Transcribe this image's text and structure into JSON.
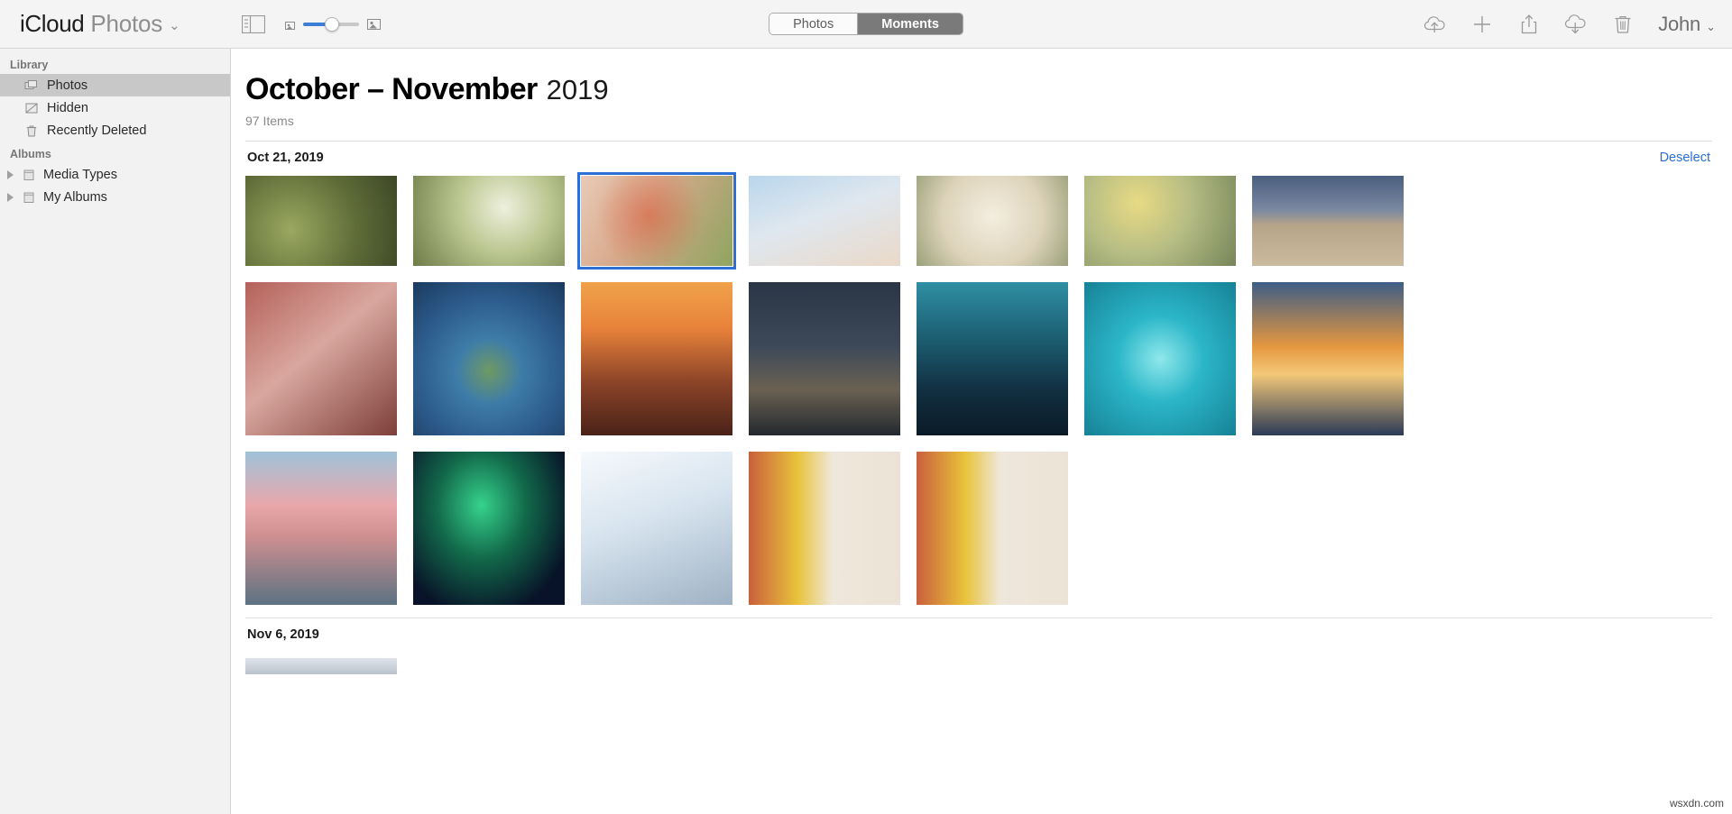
{
  "toolbar": {
    "brand_primary": "iCloud",
    "brand_secondary": "Photos",
    "brand_caret": "⌄",
    "sidebar_toggle_icon": "sidebar-toggle-icon",
    "zoom_small_icon": "thumbnail-small-icon",
    "zoom_large_icon": "thumbnail-large-icon",
    "segments": [
      {
        "label": "Photos",
        "active": false
      },
      {
        "label": "Moments",
        "active": true
      }
    ],
    "actions": [
      {
        "name": "upload-icon",
        "title": "Upload"
      },
      {
        "name": "add-icon",
        "title": "Add"
      },
      {
        "name": "share-icon",
        "title": "Share"
      },
      {
        "name": "download-icon",
        "title": "Download"
      },
      {
        "name": "delete-icon",
        "title": "Delete"
      }
    ],
    "account_name": "John",
    "account_caret": "⌄"
  },
  "sidebar": {
    "sections": [
      {
        "title": "Library",
        "items": [
          {
            "label": "Photos",
            "icon": "photos-stack-icon",
            "selected": true
          },
          {
            "label": "Hidden",
            "icon": "hidden-icon",
            "selected": false
          },
          {
            "label": "Recently Deleted",
            "icon": "trash-icon",
            "selected": false
          }
        ]
      },
      {
        "title": "Albums",
        "items": [
          {
            "label": "Media Types",
            "icon": "album-folder-icon",
            "disclosure": true
          },
          {
            "label": "My Albums",
            "icon": "album-folder-icon",
            "disclosure": true
          }
        ]
      }
    ]
  },
  "main": {
    "title_main": "October – November",
    "title_year": "2019",
    "item_count": "97 Items",
    "groups": [
      {
        "date": "Oct 21, 2019",
        "action_label": "Deselect",
        "rows": [
          {
            "height": "short",
            "photos": [
              {
                "name": "photo-birdhouse-autumn",
                "selected": false,
                "colors": [
                  "#7d8a52",
                  "#4a5530",
                  "#a9b274"
                ]
              },
              {
                "name": "photo-blossom-tree",
                "selected": false,
                "colors": [
                  "#cfd9b2",
                  "#7e8b54",
                  "#eef0dd"
                ]
              },
              {
                "name": "photo-red-leaf-hand",
                "selected": true,
                "colors": [
                  "#e8c9b4",
                  "#c8452a",
                  "#8ea560"
                ]
              },
              {
                "name": "photo-sky-pastel",
                "selected": false,
                "colors": [
                  "#cfe0ef",
                  "#eadcd0",
                  "#9fc4e2"
                ]
              },
              {
                "name": "photo-white-roses",
                "selected": false,
                "colors": [
                  "#e6dfcd",
                  "#b5ab8a",
                  "#f2ecdd"
                ]
              },
              {
                "name": "photo-yellow-rose",
                "selected": false,
                "colors": [
                  "#b9bd8e",
                  "#e3d27a",
                  "#7e8b5a"
                ]
              },
              {
                "name": "photo-desert-road",
                "selected": false,
                "colors": [
                  "#3f4f6a",
                  "#9d8b74",
                  "#c9b79c"
                ]
              }
            ]
          },
          {
            "height": "tall",
            "photos": [
              {
                "name": "photo-pink-blossom-wall",
                "selected": false,
                "colors": [
                  "#a4524a",
                  "#d8a6a0",
                  "#6d3632"
                ]
              },
              {
                "name": "photo-tiny-planet-castle",
                "selected": false,
                "colors": [
                  "#2d5d8e",
                  "#6fa3c9",
                  "#1d3d60"
                ]
              },
              {
                "name": "photo-palm-street-sunset",
                "selected": false,
                "colors": [
                  "#e8823a",
                  "#5a2a20",
                  "#f4c26a"
                ]
              },
              {
                "name": "photo-night-city-street",
                "selected": false,
                "colors": [
                  "#1f2734",
                  "#4b5565",
                  "#c8894a"
                ]
              },
              {
                "name": "photo-city-skyline-dusk",
                "selected": false,
                "colors": [
                  "#1f5f70",
                  "#0d2230",
                  "#3ea2b5"
                ]
              },
              {
                "name": "photo-heart-island-lagoon",
                "selected": false,
                "colors": [
                  "#2bb6c8",
                  "#1a7e92",
                  "#6fe0e8"
                ]
              },
              {
                "name": "photo-eiffel-tower-sunset",
                "selected": false,
                "colors": [
                  "#e5973f",
                  "#2b3a57",
                  "#f3c878"
                ]
              }
            ]
          },
          {
            "height": "tall",
            "photos": [
              {
                "name": "photo-lake-pink-clouds",
                "selected": false,
                "colors": [
                  "#e3a3a8",
                  "#4f6f7e",
                  "#f0d0c8"
                ]
              },
              {
                "name": "photo-aurora-green",
                "selected": false,
                "colors": [
                  "#0b1630",
                  "#1fa86e",
                  "#061022"
                ]
              },
              {
                "name": "photo-snow-forest-river",
                "selected": false,
                "colors": [
                  "#dfe8f0",
                  "#8fa4b6",
                  "#f5f8fb"
                ]
              },
              {
                "name": "photo-ginkgo-window-1",
                "selected": false,
                "colors": [
                  "#e8c23a",
                  "#e9e0d4",
                  "#c2603f"
                ]
              },
              {
                "name": "photo-ginkgo-window-2",
                "selected": false,
                "colors": [
                  "#e8c23a",
                  "#e9e0d4",
                  "#c2603f"
                ]
              }
            ]
          }
        ]
      },
      {
        "date": "Nov 6, 2019",
        "action_label": "",
        "rows": []
      }
    ]
  },
  "watermark": "wsxdn.com",
  "colors": {
    "accent_blue": "#2b6fd6",
    "slider_blue": "#3b7fd4",
    "selection_gray": "#c8c8c8",
    "toolbar_bg": "#f4f4f4",
    "sidebar_bg": "#f2f2f2"
  }
}
